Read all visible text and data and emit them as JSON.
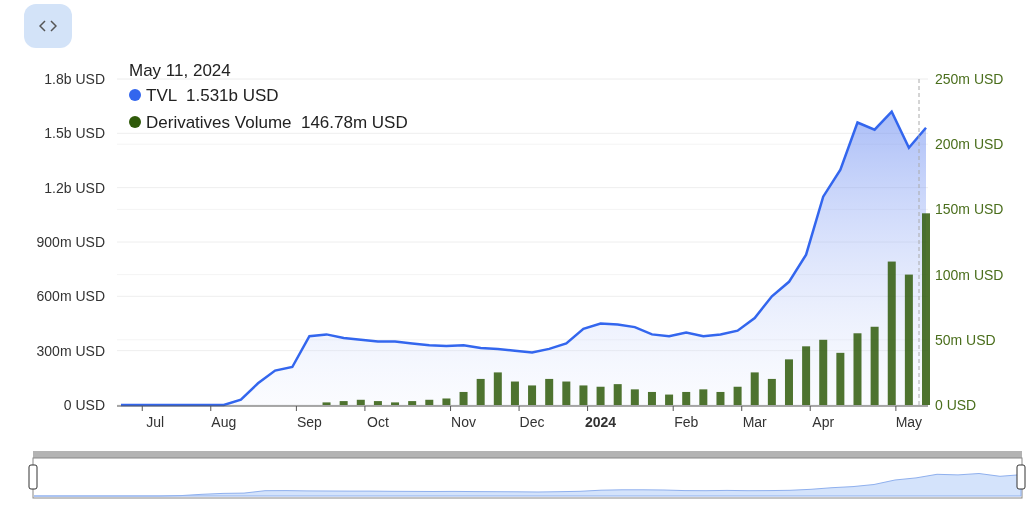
{
  "chart": {
    "chart_data": {
      "type": "line",
      "grid": true,
      "categories": [
        null,
        null,
        "Jul",
        null,
        null,
        null,
        "Aug",
        null,
        null,
        null,
        null,
        "Sep",
        null,
        null,
        null,
        "Oct",
        null,
        null,
        null,
        null,
        "Nov",
        null,
        null,
        null,
        "Dec",
        null,
        null,
        null,
        "**2024**",
        null,
        null,
        null,
        null,
        "Feb",
        null,
        null,
        null,
        "Mar",
        null,
        null,
        null,
        "Apr",
        null,
        null,
        null,
        null,
        "May",
        null
      ],
      "series": [
        {
          "name": "TVL",
          "color": "#3366ee",
          "values": [
            0,
            0,
            0,
            0,
            0,
            0,
            0,
            30000000,
            120000000,
            190000000,
            210000000,
            380000000,
            390000000,
            370000000,
            360000000,
            350000000,
            350000000,
            340000000,
            330000000,
            325000000,
            330000000,
            315000000,
            310000000,
            300000000,
            290000000,
            310000000,
            340000000,
            420000000,
            450000000,
            445000000,
            430000000,
            390000000,
            380000000,
            400000000,
            380000000,
            390000000,
            410000000,
            480000000,
            600000000,
            680000000,
            830000000,
            1150000000,
            1300000000,
            1560000000,
            1520000000,
            1620000000,
            1420000000,
            1531000000
          ]
        },
        {
          "name": "Derivatives Volume",
          "type": "bar",
          "axis": "y2",
          "color": "#2f5a0a",
          "values": [
            0,
            0,
            0,
            0,
            0,
            0,
            0,
            0,
            0,
            0,
            0,
            0,
            2,
            3,
            4,
            3,
            2,
            3,
            4,
            5,
            10,
            20,
            25,
            18,
            15,
            20,
            18,
            15,
            14,
            16,
            12,
            10,
            8,
            10,
            12,
            10,
            14,
            25,
            20,
            35,
            45,
            50,
            40,
            55,
            60,
            110,
            100,
            147
          ]
        }
      ],
      "ylim": [
        0,
        1800000000
      ],
      "yticks": [
        {
          "value": 0,
          "label": "0 USD"
        },
        {
          "value": 300000000,
          "label": "300m USD"
        },
        {
          "value": 600000000,
          "label": "600m USD"
        },
        {
          "value": 900000000,
          "label": "900m USD"
        },
        {
          "value": 1200000000,
          "label": "1.2b USD"
        },
        {
          "value": 1500000000,
          "label": "1.5b USD"
        },
        {
          "value": 1800000000,
          "label": "1.8b USD"
        }
      ],
      "y2lim": [
        0,
        250
      ],
      "y2ticks": [
        {
          "value": 0,
          "label": "0 USD"
        },
        {
          "value": 50,
          "label": "50m USD"
        },
        {
          "value": 100,
          "label": "100m USD"
        },
        {
          "value": 150,
          "label": "150m USD"
        },
        {
          "value": 200,
          "label": "200m USD"
        },
        {
          "value": 250,
          "label": "250m USD"
        }
      ]
    },
    "tooltip": {
      "date": "May 11, 2024",
      "items": [
        {
          "value": "1.531b USD"
        },
        {
          "value": "146.78m USD"
        }
      ]
    }
  }
}
